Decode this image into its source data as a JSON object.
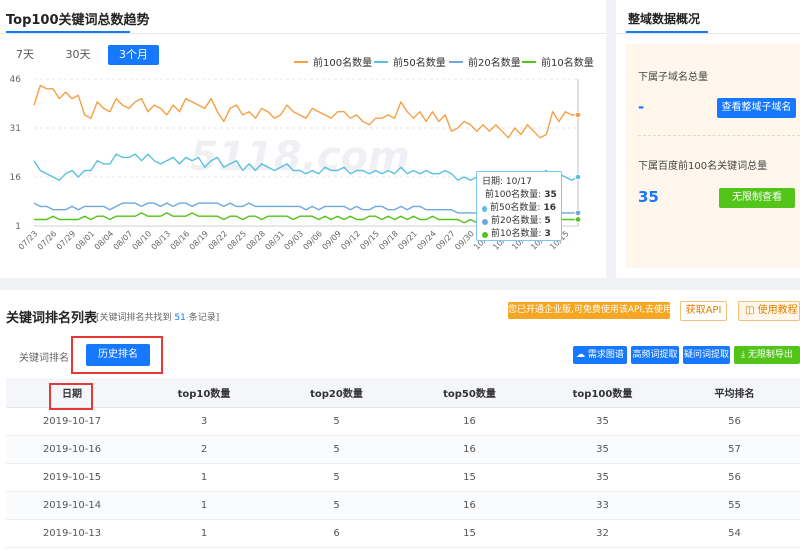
{
  "trend": {
    "title": "Top100关键词总数趋势",
    "ranges": [
      "7天",
      "30天",
      "3个月"
    ],
    "active_range": 2,
    "watermark": "5118.com"
  },
  "chart_data": {
    "type": "line",
    "x": [
      "07/23",
      "07/24",
      "07/25",
      "07/26",
      "07/27",
      "07/28",
      "07/29",
      "07/30",
      "07/31",
      "08/01",
      "08/02",
      "08/03",
      "08/04",
      "08/05",
      "08/06",
      "08/07",
      "08/08",
      "08/09",
      "08/10",
      "08/11",
      "08/12",
      "08/13",
      "08/14",
      "08/15",
      "08/16",
      "08/17",
      "08/18",
      "08/19",
      "08/20",
      "08/21",
      "08/22",
      "08/23",
      "08/24",
      "08/25",
      "08/26",
      "08/27",
      "08/28",
      "08/29",
      "08/30",
      "08/31",
      "09/01",
      "09/02",
      "09/03",
      "09/04",
      "09/05",
      "09/06",
      "09/07",
      "09/08",
      "09/09",
      "09/10",
      "09/11",
      "09/12",
      "09/13",
      "09/14",
      "09/15",
      "09/16",
      "09/17",
      "09/18",
      "09/19",
      "09/20",
      "09/21",
      "09/22",
      "09/23",
      "09/24",
      "09/25",
      "09/26",
      "09/27",
      "09/28",
      "09/29",
      "09/30",
      "10/01",
      "10/02",
      "10/03",
      "10/04",
      "10/05",
      "10/06",
      "10/07",
      "10/08",
      "10/09",
      "10/10",
      "10/11",
      "10/12",
      "10/13",
      "10/14",
      "10/15",
      "10/16",
      "10/17"
    ],
    "xtick_labels": [
      "07/23",
      "07/26",
      "07/29",
      "08/01",
      "08/04",
      "08/07",
      "08/10",
      "08/13",
      "08/16",
      "08/19",
      "08/22",
      "08/25",
      "08/28",
      "08/31",
      "09/03",
      "09/06",
      "09/09",
      "09/12",
      "09/15",
      "09/18",
      "09/21",
      "09/24",
      "09/27",
      "09/30",
      "10/03",
      "10/06",
      "10/09",
      "10/12",
      "10/15"
    ],
    "yticks": [
      1,
      16,
      31,
      46
    ],
    "ylim": [
      1,
      46
    ],
    "series": [
      {
        "name": "前100名数量",
        "color": "#f5a046",
        "values": [
          38,
          44,
          43,
          43,
          40,
          42,
          40,
          41,
          35,
          34,
          39,
          37,
          36,
          40,
          38,
          37,
          39,
          40,
          36,
          38,
          37,
          35,
          38,
          36,
          40,
          39,
          38,
          37,
          40,
          36,
          33,
          37,
          38,
          35,
          36,
          34,
          37,
          36,
          34,
          35,
          38,
          36,
          35,
          34,
          37,
          36,
          35,
          34,
          36,
          36,
          34,
          35,
          33,
          32,
          34,
          34,
          35,
          34,
          39,
          36,
          34,
          36,
          33,
          36,
          33,
          35,
          30,
          31,
          33,
          32,
          30,
          32,
          30,
          32,
          30,
          28,
          31,
          29,
          32,
          30,
          28,
          29,
          36,
          33,
          36,
          35,
          35
        ]
      },
      {
        "name": "前50名数量",
        "color": "#5bc0de",
        "values": [
          21,
          18,
          17,
          16,
          15,
          17,
          18,
          16,
          18,
          18,
          21,
          20,
          20,
          23,
          22,
          22,
          23,
          21,
          23,
          21,
          20,
          21,
          22,
          20,
          22,
          21,
          22,
          19,
          21,
          22,
          19,
          20,
          21,
          18,
          20,
          18,
          20,
          19,
          18,
          19,
          20,
          18,
          18,
          17,
          18,
          17,
          19,
          18,
          18,
          19,
          17,
          18,
          18,
          17,
          18,
          17,
          18,
          17,
          19,
          17,
          18,
          17,
          18,
          17,
          17,
          18,
          17,
          15,
          16,
          15,
          16,
          15,
          16,
          14,
          15,
          15,
          16,
          15,
          16,
          16,
          17,
          18,
          15,
          17,
          16,
          15,
          16
        ]
      },
      {
        "name": "前20名数量",
        "color": "#6fa8dc",
        "values": [
          8,
          7,
          7,
          6,
          6,
          6,
          7,
          6,
          7,
          7,
          7,
          7,
          6,
          7,
          8,
          8,
          8,
          7,
          8,
          8,
          7,
          8,
          7,
          8,
          8,
          7,
          8,
          8,
          8,
          8,
          7,
          8,
          7,
          7,
          8,
          7,
          7,
          7,
          7,
          7,
          7,
          7,
          7,
          6,
          7,
          6,
          7,
          7,
          7,
          7,
          6,
          7,
          6,
          6,
          7,
          7,
          6,
          6,
          7,
          6,
          7,
          7,
          6,
          6,
          6,
          6,
          6,
          5,
          5,
          5,
          5,
          6,
          5,
          6,
          5,
          5,
          5,
          5,
          6,
          5,
          5,
          6,
          5,
          5,
          5,
          5,
          5
        ]
      },
      {
        "name": "前10名数量",
        "color": "#52c41a",
        "values": [
          3,
          3,
          3,
          4,
          3,
          3,
          3,
          3,
          4,
          3,
          4,
          4,
          3,
          4,
          4,
          4,
          4,
          5,
          4,
          4,
          4,
          5,
          4,
          4,
          4,
          5,
          4,
          4,
          4,
          4,
          3,
          4,
          4,
          3,
          4,
          4,
          3,
          4,
          4,
          4,
          4,
          3,
          4,
          4,
          4,
          3,
          4,
          3,
          4,
          3,
          4,
          3,
          3,
          4,
          4,
          3,
          4,
          3,
          4,
          3,
          4,
          3,
          3,
          4,
          3,
          3,
          3,
          3,
          2,
          3,
          2,
          3,
          2,
          3,
          2,
          3,
          2,
          3,
          3,
          2,
          3,
          3,
          3,
          3,
          3,
          3,
          3
        ]
      }
    ],
    "tooltip": {
      "date_label": "日期: 10/17",
      "rows": [
        {
          "name": "前100名数量:",
          "value": "35",
          "color": "#f5a046"
        },
        {
          "name": "前50名数量:",
          "value": "16",
          "color": "#5bc0de"
        },
        {
          "name": "前20名数量:",
          "value": "5",
          "color": "#6fa8dc"
        },
        {
          "name": "前10名数量:",
          "value": "3",
          "color": "#52c41a"
        }
      ]
    }
  },
  "overview": {
    "title": "整域数据概况",
    "subdomain_label": "下属子域名总量",
    "subdomain_value": "-",
    "subdomain_button": "查看整域子域名",
    "keywords_label": "下属百度前100名关键词总量",
    "keywords_value": "35",
    "keywords_button": "无限制查看"
  },
  "keywords": {
    "title": "关键词排名列表",
    "count_prefix": "[关键词排名共找到",
    "count_value": "51",
    "count_suffix": "条记录]",
    "notice": "您已开通企业版,可免费使用该API,去使用",
    "api_button": "获取API",
    "tutorial_button": "使用教程",
    "tab_label": "关键词排名",
    "history_button": "历史排名",
    "tools": [
      "需求图谱",
      "高频词提取",
      "疑问词提取",
      "无限制导出"
    ],
    "columns": [
      "日期",
      "top10数量",
      "top20数量",
      "top50数量",
      "top100数量",
      "平均排名"
    ],
    "rows": [
      [
        "2019-10-17",
        "3",
        "5",
        "16",
        "35",
        "56"
      ],
      [
        "2019-10-16",
        "2",
        "5",
        "16",
        "35",
        "57"
      ],
      [
        "2019-10-15",
        "1",
        "5",
        "15",
        "35",
        "56"
      ],
      [
        "2019-10-14",
        "1",
        "5",
        "16",
        "33",
        "55"
      ],
      [
        "2019-10-13",
        "1",
        "6",
        "15",
        "32",
        "54"
      ]
    ]
  }
}
